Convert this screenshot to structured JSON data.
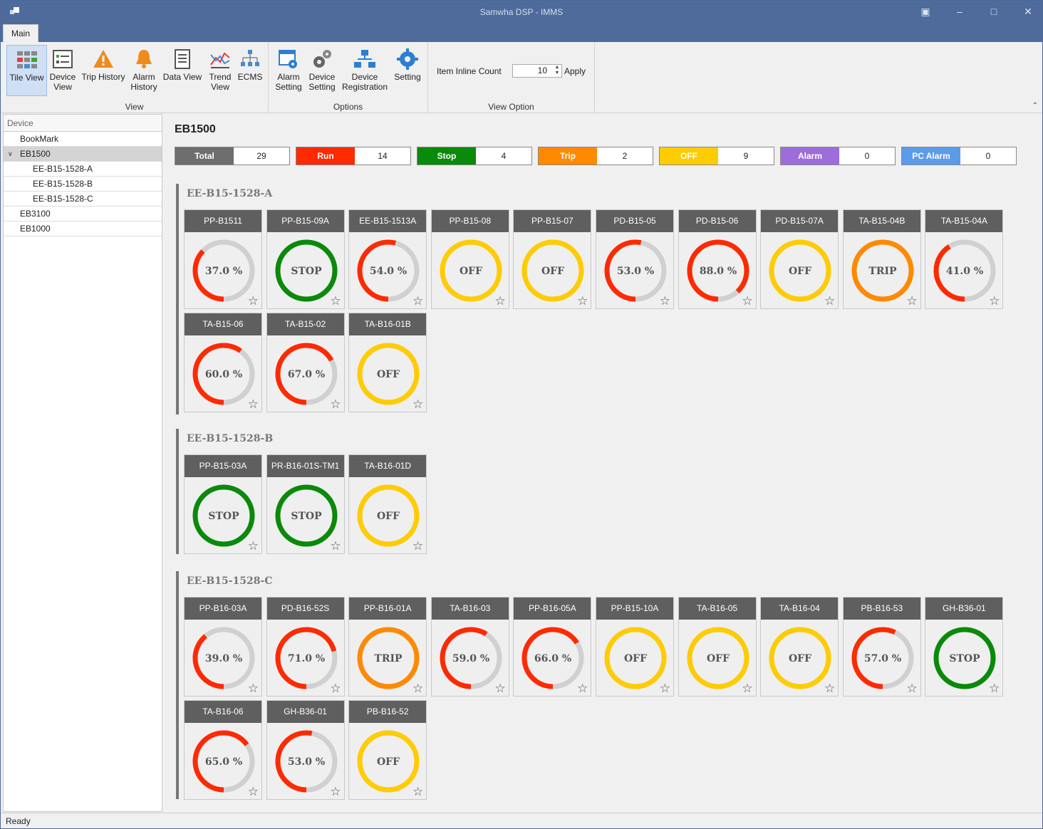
{
  "window": {
    "title": "Samwha DSP - IMMS"
  },
  "ribbon": {
    "tab": "Main",
    "view_group": {
      "label": "View",
      "buttons": [
        "Tile View",
        "Device View",
        "Trip History",
        "Alarm History",
        "Data View",
        "Trend View",
        "ECMS"
      ]
    },
    "options_group": {
      "label": "Options",
      "buttons": [
        "Alarm Setting",
        "Device Setting",
        "Device Registration",
        "Setting"
      ]
    },
    "view_option_group": {
      "label": "View Option",
      "item_inline_label": "Item Inline Count",
      "item_inline_value": "10",
      "apply_label": "Apply"
    }
  },
  "tree": {
    "header": "Device",
    "items": [
      "BookMark",
      "EB1500",
      "EE-B15-1528-A",
      "EE-B15-1528-B",
      "EE-B15-1528-C",
      "EB3100",
      "EB1000"
    ],
    "selected": "EB1500"
  },
  "main": {
    "title": "EB1500",
    "summary": [
      {
        "label": "Total",
        "value": "29",
        "color": "#6e6e6e",
        "text_color": "#ffffff"
      },
      {
        "label": "Run",
        "value": "14",
        "color": "#ff2a00",
        "text_color": "#ffffff"
      },
      {
        "label": "Stop",
        "value": "4",
        "color": "#0a8a0a",
        "text_color": "#ffffff"
      },
      {
        "label": "Trip",
        "value": "2",
        "color": "#ff8a00",
        "text_color": "#ffffff"
      },
      {
        "label": "OFF",
        "value": "9",
        "color": "#ffcc00",
        "text_color": "#ffffff"
      },
      {
        "label": "Alarm",
        "value": "0",
        "color": "#9c6ddb",
        "text_color": "#ffffff"
      },
      {
        "label": "PC Alarm",
        "value": "0",
        "color": "#5b9bea",
        "text_color": "#ffffff"
      }
    ],
    "sections": [
      {
        "title": "EE-B15-1528-A",
        "tiles": [
          {
            "name": "PP-B1511",
            "status": "run",
            "value": 37.0,
            "label": "37.0 %"
          },
          {
            "name": "PP-B15-09A",
            "status": "stop",
            "value": 100,
            "label": "STOP"
          },
          {
            "name": "EE-B15-1513A",
            "status": "run",
            "value": 54.0,
            "label": "54.0 %"
          },
          {
            "name": "PP-B15-08",
            "status": "off",
            "value": 100,
            "label": "OFF"
          },
          {
            "name": "PP-B15-07",
            "status": "off",
            "value": 100,
            "label": "OFF"
          },
          {
            "name": "PD-B15-05",
            "status": "run",
            "value": 53.0,
            "label": "53.0 %"
          },
          {
            "name": "PD-B15-06",
            "status": "run",
            "value": 88.0,
            "label": "88.0 %"
          },
          {
            "name": "PD-B15-07A",
            "status": "off",
            "value": 100,
            "label": "OFF"
          },
          {
            "name": "TA-B15-04B",
            "status": "trip",
            "value": 100,
            "label": "TRIP"
          },
          {
            "name": "TA-B15-04A",
            "status": "run",
            "value": 41.0,
            "label": "41.0 %"
          },
          {
            "name": "TA-B15-06",
            "status": "run",
            "value": 60.0,
            "label": "60.0 %"
          },
          {
            "name": "TA-B15-02",
            "status": "run",
            "value": 67.0,
            "label": "67.0 %"
          },
          {
            "name": "TA-B16-01B",
            "status": "off",
            "value": 100,
            "label": "OFF"
          }
        ]
      },
      {
        "title": "EE-B15-1528-B",
        "tiles": [
          {
            "name": "PP-B15-03A",
            "status": "stop",
            "value": 100,
            "label": "STOP"
          },
          {
            "name": "PR-B16-01S-TM1",
            "status": "stop",
            "value": 100,
            "label": "STOP"
          },
          {
            "name": "TA-B16-01D",
            "status": "off",
            "value": 100,
            "label": "OFF"
          }
        ]
      },
      {
        "title": "EE-B15-1528-C",
        "tiles": [
          {
            "name": "PP-B16-03A",
            "status": "run",
            "value": 39.0,
            "label": "39.0 %"
          },
          {
            "name": "PD-B16-52S",
            "status": "run",
            "value": 71.0,
            "label": "71.0 %"
          },
          {
            "name": "PP-B16-01A",
            "status": "trip",
            "value": 100,
            "label": "TRIP"
          },
          {
            "name": "TA-B16-03",
            "status": "run",
            "value": 59.0,
            "label": "59.0 %"
          },
          {
            "name": "PP-B16-05A",
            "status": "run",
            "value": 66.0,
            "label": "66.0 %"
          },
          {
            "name": "PP-B15-10A",
            "status": "off",
            "value": 100,
            "label": "OFF"
          },
          {
            "name": "TA-B16-05",
            "status": "off",
            "value": 100,
            "label": "OFF"
          },
          {
            "name": "TA-B16-04",
            "status": "off",
            "value": 100,
            "label": "OFF"
          },
          {
            "name": "PB-B16-53",
            "status": "run",
            "value": 57.0,
            "label": "57.0 %"
          },
          {
            "name": "GH-B36-01",
            "status": "stop",
            "value": 100,
            "label": "STOP"
          },
          {
            "name": "TA-B16-06",
            "status": "run",
            "value": 65.0,
            "label": "65.0 %"
          },
          {
            "name": "GH-B36-01",
            "status": "run",
            "value": 53.0,
            "label": "53.0 %"
          },
          {
            "name": "PB-B16-52",
            "status": "off",
            "value": 100,
            "label": "OFF"
          }
        ]
      }
    ],
    "status_colors": {
      "run": "#ff2a00",
      "stop": "#0a8a0a",
      "off": "#ffcc00",
      "trip": "#ff8a00",
      "track": "#d0d0d0"
    }
  },
  "statusbar": {
    "text": "Ready"
  }
}
